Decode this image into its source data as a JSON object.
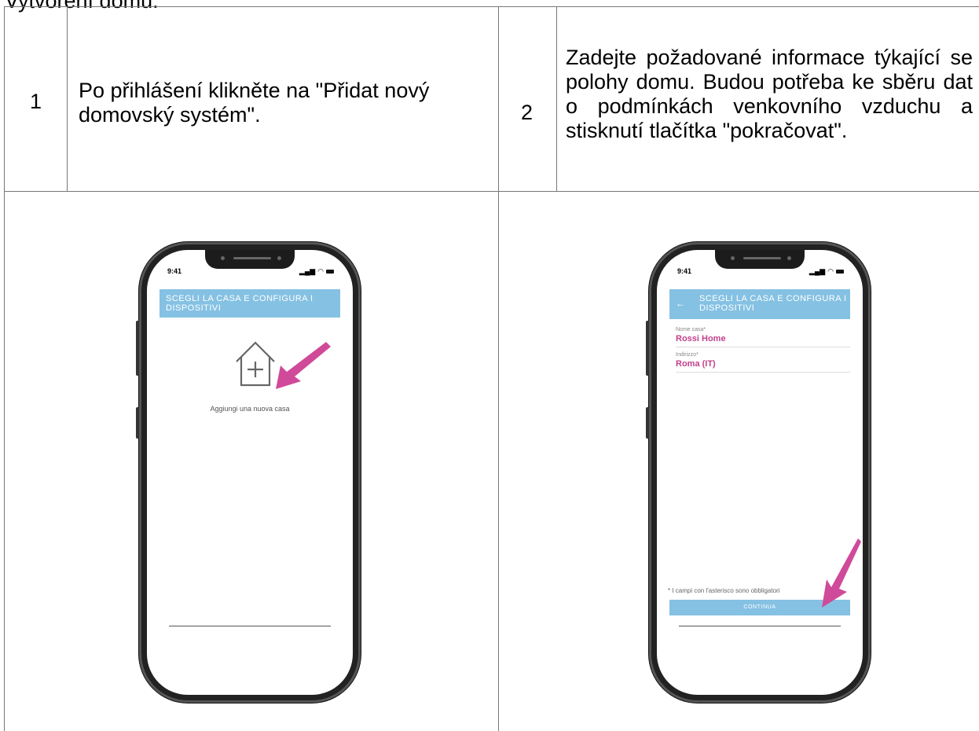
{
  "heading": "Vytvoření domu.",
  "steps": [
    {
      "number": "1",
      "text": "Po přihlášení klikněte na \"Přidat nový domovský systém\"."
    },
    {
      "number": "2",
      "text": "Zadejte požadované informace týkající se polohy domu. Budou potřeba ke sběru dat o podmínkách venkovního vzduchu a stisknutí tlačítka \"pokračovat\"."
    }
  ],
  "phone_left": {
    "time": "9:41",
    "title": "SCEGLI LA CASA E CONFIGURA I DISPOSITIVI",
    "add_home_label": "Aggiungi una nuova casa",
    "icons": [
      "add-home-icon",
      "arrow-icon"
    ]
  },
  "phone_right": {
    "time": "9:41",
    "back_icon": "back-arrow-icon",
    "title": "SCEGLI LA CASA E CONFIGURA I DISPOSITIVI",
    "fields": [
      {
        "label": "Nome casa*",
        "value": "Rossi Home"
      },
      {
        "label": "Indirizzo*",
        "value": "Roma (IT)"
      }
    ],
    "note": "* I campi con l'asterisco sono obbligatori",
    "continue_label": "CONTINUA"
  },
  "colors": {
    "appbar": "#85c1e3",
    "accent": "#c2408d",
    "arrow": "#d04a9a"
  }
}
